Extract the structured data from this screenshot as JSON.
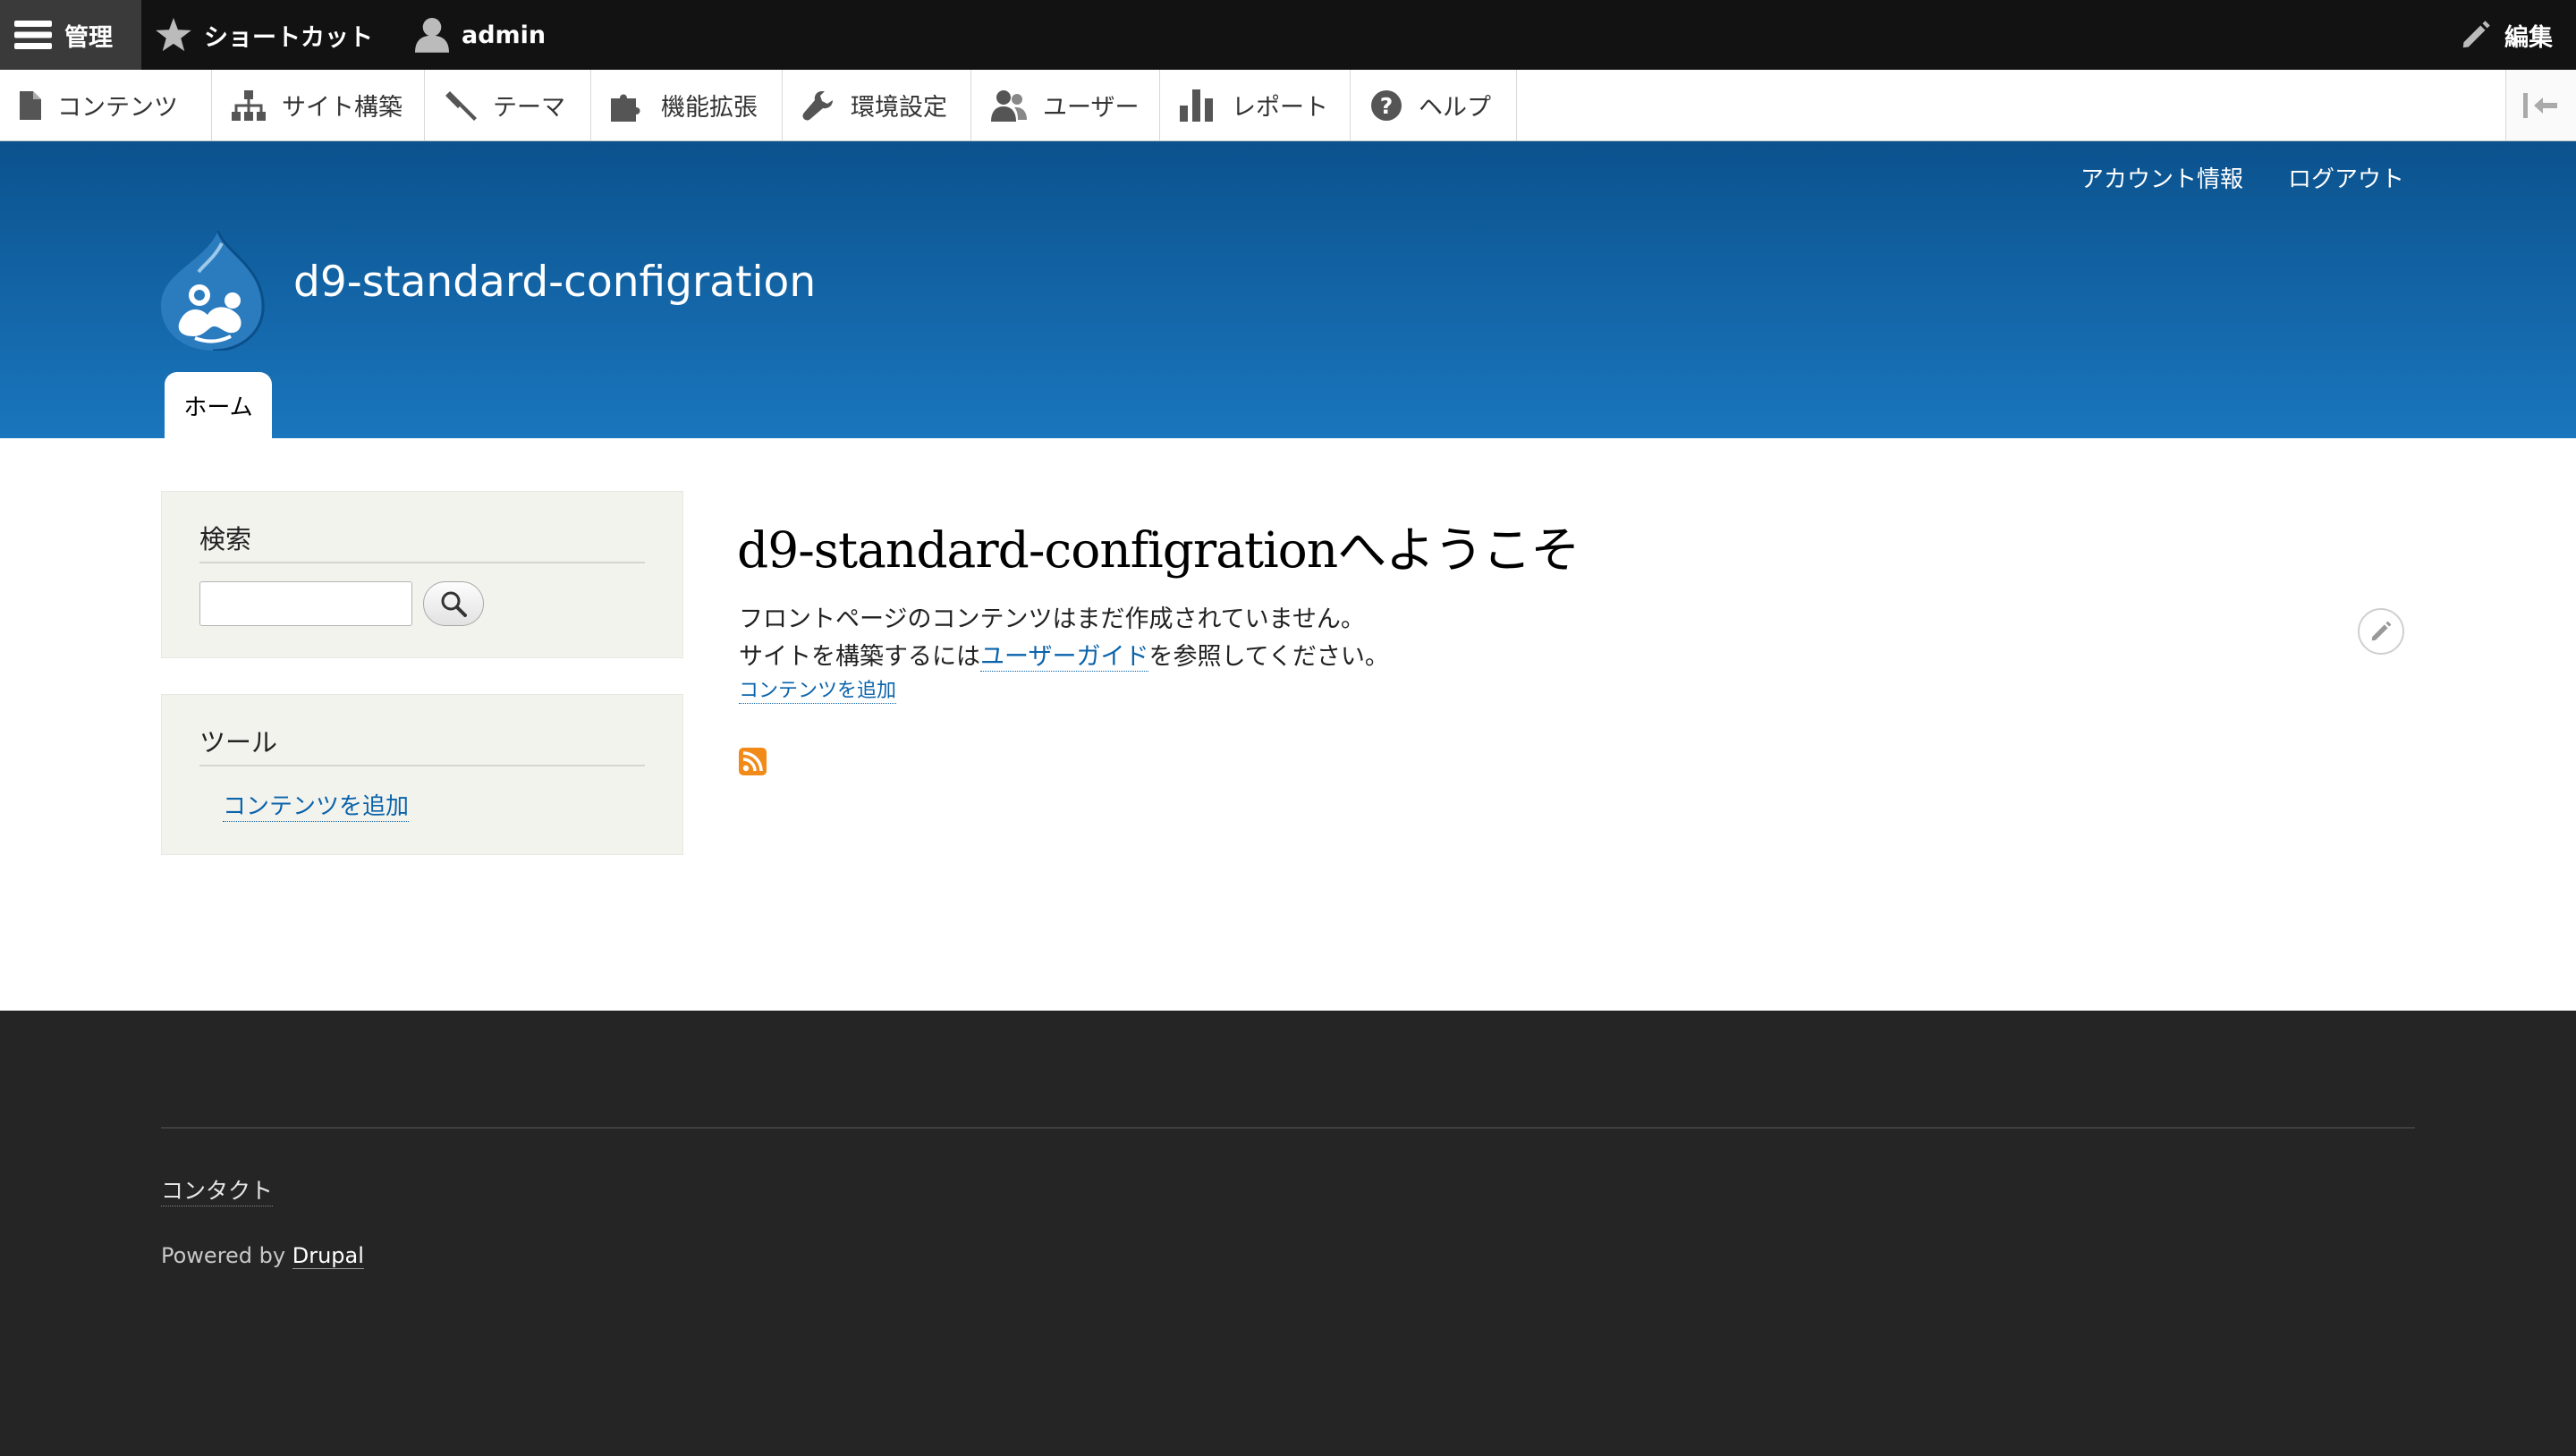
{
  "toolbar": {
    "manage_label": "管理",
    "shortcuts_label": "ショートカット",
    "user_label": "admin",
    "edit_label": "編集"
  },
  "tray": {
    "items": [
      {
        "label": "コンテンツ",
        "icon": "document-icon"
      },
      {
        "label": "サイト構築",
        "icon": "sitemap-icon"
      },
      {
        "label": "テーマ",
        "icon": "paint-icon"
      },
      {
        "label": "機能拡張",
        "icon": "puzzle-icon"
      },
      {
        "label": "環境設定",
        "icon": "wrench-icon"
      },
      {
        "label": "ユーザー",
        "icon": "people-icon"
      },
      {
        "label": "レポート",
        "icon": "bar-chart-icon"
      },
      {
        "label": "ヘルプ",
        "icon": "question-icon"
      }
    ]
  },
  "header": {
    "secondary_links": [
      "アカウント情報",
      "ログアウト"
    ],
    "site_name": "d9-standard-configration",
    "tabs": [
      "ホーム"
    ],
    "colors": {
      "gradient_top": "#0b528e",
      "gradient_bottom": "#1a76bd"
    }
  },
  "sidebar": {
    "search": {
      "title": "検索",
      "input_value": ""
    },
    "tools": {
      "title": "ツール",
      "link": "コンテンツを追加"
    }
  },
  "main": {
    "title": "d9-standard-configrationへようこそ",
    "line1": "フロントページのコンテンツはまだ作成されていません。",
    "line2_before": "サイトを構築するには",
    "line2_link": "ユーザーガイド",
    "line2_after": "を参照してください。",
    "add_content_link": "コンテンツを追加"
  },
  "footer": {
    "contact_link": "コンタクト",
    "powered_prefix": "Powered by ",
    "powered_link": "Drupal"
  }
}
